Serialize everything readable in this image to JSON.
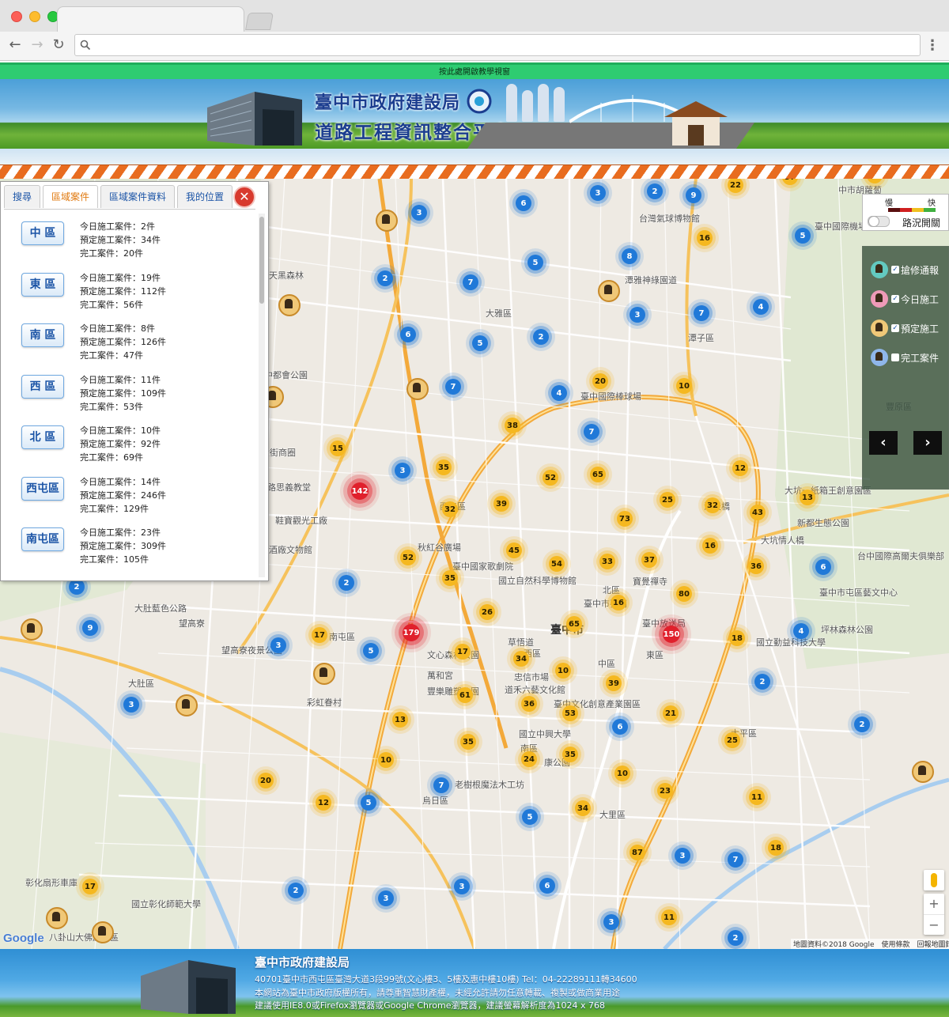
{
  "notice": {
    "text": "按此處開啟教學視窗"
  },
  "banner": {
    "title": "臺中市政府建設局",
    "subtitle": "道路工程資訊整合平台"
  },
  "panel": {
    "tabs": [
      "搜尋",
      "區域案件",
      "區域案件資料",
      "我的位置"
    ],
    "active_tab": "區域案件",
    "districts": [
      {
        "name": "中 區",
        "today": "今日施工案件：2件",
        "planned": "預定施工案件：34件",
        "done": "完工案件：20件"
      },
      {
        "name": "東 區",
        "today": "今日施工案件：19件",
        "planned": "預定施工案件：112件",
        "done": "完工案件：56件"
      },
      {
        "name": "南 區",
        "today": "今日施工案件：8件",
        "planned": "預定施工案件：126件",
        "done": "完工案件：47件"
      },
      {
        "name": "西 區",
        "today": "今日施工案件：11件",
        "planned": "預定施工案件：109件",
        "done": "完工案件：53件"
      },
      {
        "name": "北 區",
        "today": "今日施工案件：10件",
        "planned": "預定施工案件：92件",
        "done": "完工案件：69件"
      },
      {
        "name": "西屯區",
        "today": "今日施工案件：14件",
        "planned": "預定施工案件：246件",
        "done": "完工案件：129件"
      },
      {
        "name": "南屯區",
        "today": "今日施工案件：23件",
        "planned": "預定施工案件：309件",
        "done": "完工案件：105件"
      }
    ]
  },
  "traffic": {
    "slow": "慢",
    "fast": "快",
    "toggle_label": "路況開關",
    "colors": [
      "#5a0f0f",
      "#d02020",
      "#f0c020",
      "#40b040"
    ]
  },
  "layers": [
    {
      "label": "搶修通報",
      "checked": true,
      "color": "#63c9c0"
    },
    {
      "label": "今日施工",
      "checked": true,
      "color": "#ef9ab8"
    },
    {
      "label": "預定施工",
      "checked": true,
      "color": "#f0c878"
    },
    {
      "label": "完工案件",
      "checked": false,
      "color": "#8fb6ea"
    }
  ],
  "layer_nav": {
    "prev": "‹",
    "next": "›"
  },
  "map": {
    "labels": [
      {
        "t": "台灣氣球博物館"
      },
      {
        "t": "潭雅神綠園道"
      },
      {
        "t": "大雅區"
      },
      {
        "t": "潭子區"
      },
      {
        "t": "臺中國際機場"
      },
      {
        "t": "天黑森林"
      },
      {
        "t": "中都會公園"
      },
      {
        "t": "路思義教堂"
      },
      {
        "t": "鞋寶觀光工廠"
      },
      {
        "t": "酒廠文物館"
      },
      {
        "t": "秋紅谷廣場"
      },
      {
        "t": "臺中國家歌劇院"
      },
      {
        "t": "國立自然科學博物館"
      },
      {
        "t": "寶覺禪寺"
      },
      {
        "t": "北區"
      },
      {
        "t": "臺中市孔廟"
      },
      {
        "t": "臺中放送局"
      },
      {
        "t": "文心森林公園"
      },
      {
        "t": "草悟道"
      },
      {
        "t": "臺中市"
      },
      {
        "t": "西區"
      },
      {
        "t": "東區"
      },
      {
        "t": "中區"
      },
      {
        "t": "萬和宮"
      },
      {
        "t": "豐樂雕塑公園"
      },
      {
        "t": "忠信市場"
      },
      {
        "t": "道禾六藝文化館"
      },
      {
        "t": "臺中文化創意產業園區"
      },
      {
        "t": "國立中興大學"
      },
      {
        "t": "南區"
      },
      {
        "t": "康公園"
      },
      {
        "t": "老樹根魔法木工坊"
      },
      {
        "t": "烏日區"
      },
      {
        "t": "大里區"
      },
      {
        "t": "大坑一紙箱王創意園區"
      },
      {
        "t": "海天橋"
      },
      {
        "t": "新都生態公園"
      },
      {
        "t": "大坑情人橋"
      },
      {
        "t": "台中國際高爾夫俱樂部"
      },
      {
        "t": "臺中市屯區藝文中心"
      },
      {
        "t": "坪林森林公園"
      },
      {
        "t": "國立勤益科技大學"
      },
      {
        "t": "太平區"
      },
      {
        "t": "大肚藍色公路"
      },
      {
        "t": "望高寮"
      },
      {
        "t": "望高寮夜景公園"
      },
      {
        "t": "大肚區"
      },
      {
        "t": "南屯區"
      },
      {
        "t": "彩虹眷村"
      },
      {
        "t": "彰化扇形車庫"
      },
      {
        "t": "國立彰化師範大學"
      },
      {
        "t": "八卦山大佛風景區"
      },
      {
        "t": "大街商圈"
      },
      {
        "t": "豐原區"
      },
      {
        "t": "臺中國際棒球場"
      },
      {
        "t": "西屯區"
      },
      {
        "t": "中市胡蘿蔔"
      }
    ],
    "clusters": [
      {
        "v": "3",
        "c": "blue"
      },
      {
        "v": "6",
        "c": "blue"
      },
      {
        "v": "3",
        "c": "blue"
      },
      {
        "v": "2",
        "c": "blue"
      },
      {
        "v": "9",
        "c": "blue"
      },
      {
        "v": "22",
        "c": "yellow"
      },
      {
        "v": "37",
        "c": "yellow"
      },
      {
        "v": "11",
        "c": "yellow"
      },
      {
        "v": "5",
        "c": "blue"
      },
      {
        "v": "16",
        "c": "yellow"
      },
      {
        "v": "8",
        "c": "blue"
      },
      {
        "v": "5",
        "c": "blue"
      },
      {
        "v": "2",
        "c": "blue"
      },
      {
        "v": "7",
        "c": "blue"
      },
      {
        "v": "3",
        "c": "blue"
      },
      {
        "v": "7",
        "c": "blue"
      },
      {
        "v": "4",
        "c": "blue"
      },
      {
        "v": "6",
        "c": "blue"
      },
      {
        "v": "5",
        "c": "blue"
      },
      {
        "v": "2",
        "c": "blue"
      },
      {
        "v": "7",
        "c": "blue"
      },
      {
        "v": "20",
        "c": "yellow"
      },
      {
        "v": "10",
        "c": "yellow"
      },
      {
        "v": "4",
        "c": "blue"
      },
      {
        "v": "38",
        "c": "yellow"
      },
      {
        "v": "7",
        "c": "blue"
      },
      {
        "v": "15",
        "c": "yellow"
      },
      {
        "v": "3",
        "c": "blue"
      },
      {
        "v": "35",
        "c": "yellow"
      },
      {
        "v": "142",
        "c": "red"
      },
      {
        "v": "52",
        "c": "yellow"
      },
      {
        "v": "65",
        "c": "yellow"
      },
      {
        "v": "12",
        "c": "yellow"
      },
      {
        "v": "13",
        "c": "yellow"
      },
      {
        "v": "32",
        "c": "yellow"
      },
      {
        "v": "39",
        "c": "yellow"
      },
      {
        "v": "25",
        "c": "yellow"
      },
      {
        "v": "32",
        "c": "yellow"
      },
      {
        "v": "73",
        "c": "yellow"
      },
      {
        "v": "43",
        "c": "yellow"
      },
      {
        "v": "52",
        "c": "yellow"
      },
      {
        "v": "45",
        "c": "yellow"
      },
      {
        "v": "54",
        "c": "yellow"
      },
      {
        "v": "33",
        "c": "yellow"
      },
      {
        "v": "37",
        "c": "yellow"
      },
      {
        "v": "16",
        "c": "yellow"
      },
      {
        "v": "36",
        "c": "yellow"
      },
      {
        "v": "6",
        "c": "blue"
      },
      {
        "v": "2",
        "c": "blue"
      },
      {
        "v": "2",
        "c": "blue"
      },
      {
        "v": "35",
        "c": "yellow"
      },
      {
        "v": "80",
        "c": "yellow"
      },
      {
        "v": "16",
        "c": "yellow"
      },
      {
        "v": "26",
        "c": "yellow"
      },
      {
        "v": "65",
        "c": "yellow"
      },
      {
        "v": "9",
        "c": "blue"
      },
      {
        "v": "17",
        "c": "yellow"
      },
      {
        "v": "3",
        "c": "blue"
      },
      {
        "v": "5",
        "c": "blue"
      },
      {
        "v": "179",
        "c": "red"
      },
      {
        "v": "17",
        "c": "yellow"
      },
      {
        "v": "150",
        "c": "red"
      },
      {
        "v": "18",
        "c": "yellow"
      },
      {
        "v": "4",
        "c": "blue"
      },
      {
        "v": "34",
        "c": "yellow"
      },
      {
        "v": "10",
        "c": "yellow"
      },
      {
        "v": "39",
        "c": "yellow"
      },
      {
        "v": "2",
        "c": "blue"
      },
      {
        "v": "61",
        "c": "yellow"
      },
      {
        "v": "3",
        "c": "blue"
      },
      {
        "v": "36",
        "c": "yellow"
      },
      {
        "v": "53",
        "c": "yellow"
      },
      {
        "v": "21",
        "c": "yellow"
      },
      {
        "v": "13",
        "c": "yellow"
      },
      {
        "v": "6",
        "c": "blue"
      },
      {
        "v": "2",
        "c": "blue"
      },
      {
        "v": "35",
        "c": "yellow"
      },
      {
        "v": "25",
        "c": "yellow"
      },
      {
        "v": "24",
        "c": "yellow"
      },
      {
        "v": "35",
        "c": "yellow"
      },
      {
        "v": "10",
        "c": "yellow"
      },
      {
        "v": "20",
        "c": "yellow"
      },
      {
        "v": "10",
        "c": "yellow"
      },
      {
        "v": "7",
        "c": "blue"
      },
      {
        "v": "23",
        "c": "yellow"
      },
      {
        "v": "12",
        "c": "yellow"
      },
      {
        "v": "5",
        "c": "blue"
      },
      {
        "v": "11",
        "c": "yellow"
      },
      {
        "v": "34",
        "c": "yellow"
      },
      {
        "v": "5",
        "c": "blue"
      },
      {
        "v": "87",
        "c": "yellow"
      },
      {
        "v": "3",
        "c": "blue"
      },
      {
        "v": "18",
        "c": "yellow"
      },
      {
        "v": "7",
        "c": "blue"
      },
      {
        "v": "17",
        "c": "yellow"
      },
      {
        "v": "2",
        "c": "blue"
      },
      {
        "v": "3",
        "c": "blue"
      },
      {
        "v": "3",
        "c": "blue"
      },
      {
        "v": "6",
        "c": "blue"
      },
      {
        "v": "11",
        "c": "yellow"
      },
      {
        "v": "3",
        "c": "blue"
      },
      {
        "v": "2",
        "c": "blue"
      }
    ],
    "attribution": "地圖資料©2018 Google　使用條款　回報地圖錯誤",
    "google_logo": "Google",
    "zoom_in": "+",
    "zoom_out": "−"
  },
  "footer": {
    "title": "臺中市政府建設局",
    "address": "40701臺中市西屯區臺灣大道3段99號(文心樓3、5樓及惠中樓10樓) Tel：04-22289111轉34600",
    "copyright": "本網站為臺中市政府版權所有，請尊重智慧財產權，未經允許請勿任意轉載、複製或做商業用途",
    "browser": "建議使用IE8.0或Firefox瀏覽器或Google Chrome瀏覽器，建議螢幕解析度為1024 x 768"
  }
}
